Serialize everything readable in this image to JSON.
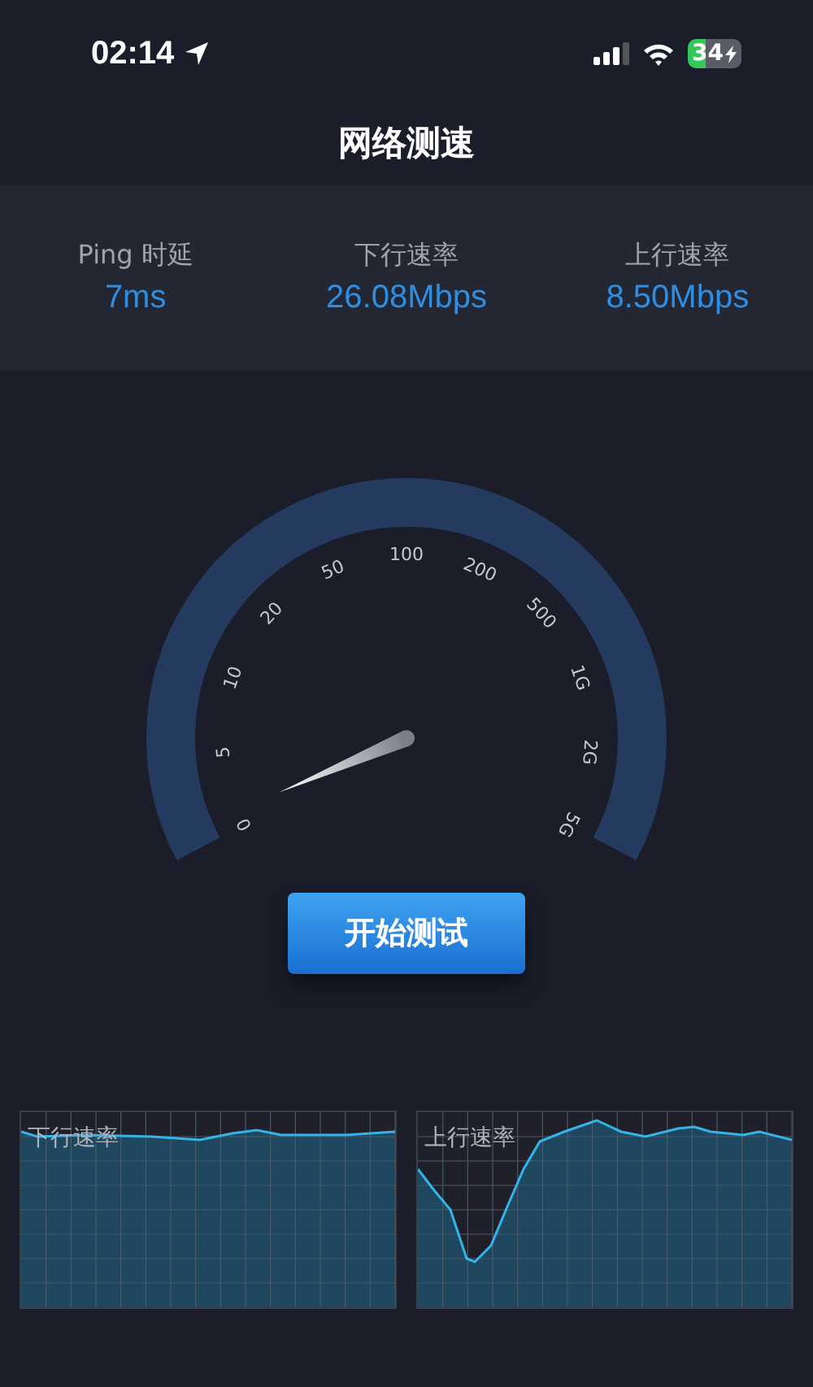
{
  "status_bar": {
    "time": "02:14",
    "battery": "34"
  },
  "title": "网络测速",
  "stats": [
    {
      "label": "Ping 时延",
      "value": "7ms"
    },
    {
      "label": "下行速率",
      "value": "26.08Mbps"
    },
    {
      "label": "上行速率",
      "value": "8.50Mbps"
    }
  ],
  "gauge": {
    "ticks": [
      "0",
      "5",
      "10",
      "20",
      "50",
      "100",
      "200",
      "500",
      "1G",
      "2G",
      "5G"
    ]
  },
  "start_button": "开始测试",
  "graphs": [
    {
      "label": "下行速率",
      "kind": "download"
    },
    {
      "label": "上行速率",
      "kind": "upload"
    }
  ]
}
